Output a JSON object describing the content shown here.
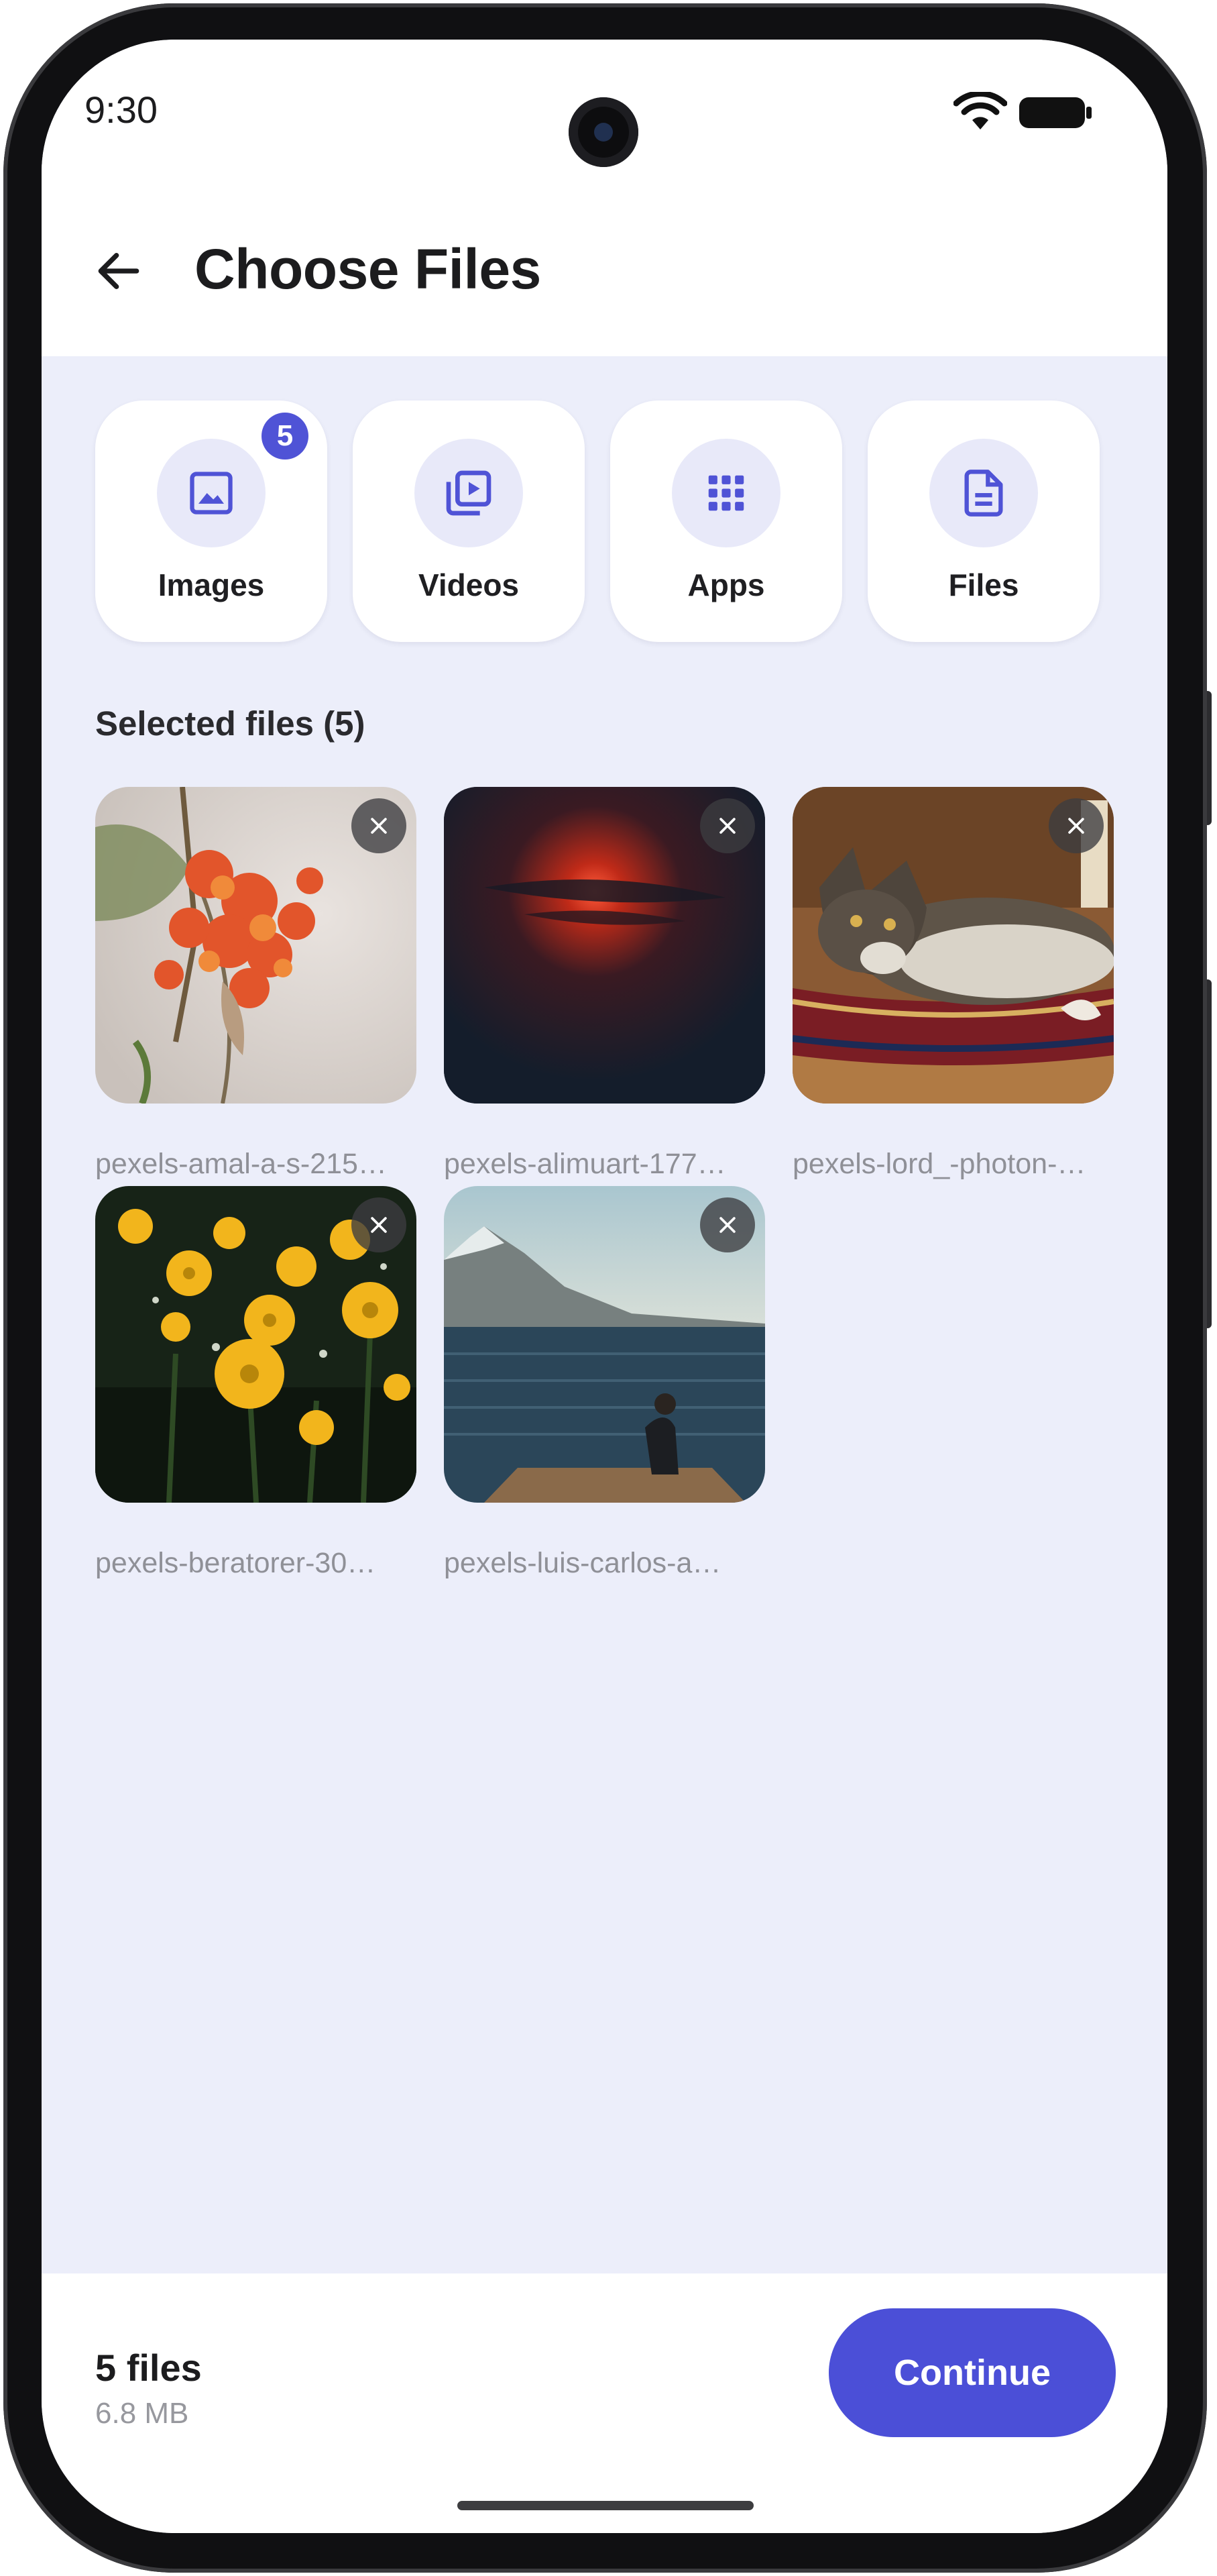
{
  "status_bar": {
    "time": "9:30",
    "wifi_icon": "wifi-icon",
    "battery_icon": "battery-icon"
  },
  "header": {
    "title": "Choose Files",
    "back_icon": "arrow-back-icon"
  },
  "categories": [
    {
      "label": "Images",
      "icon": "image-icon",
      "badge": "5"
    },
    {
      "label": "Videos",
      "icon": "video-library-icon"
    },
    {
      "label": "Apps",
      "icon": "apps-grid-icon"
    },
    {
      "label": "Files",
      "icon": "document-icon"
    }
  ],
  "selected": {
    "title": "Selected files (5)",
    "files": [
      {
        "name": "pexels-amal-a-s-215…"
      },
      {
        "name": "pexels-alimuart-177…"
      },
      {
        "name": "pexels-lord_-photon-…"
      },
      {
        "name": "pexels-beratorer-30…"
      },
      {
        "name": "pexels-luis-carlos-a…"
      }
    ]
  },
  "footer": {
    "count": "5 files",
    "size": "6.8 MB",
    "continue_label": "Continue"
  },
  "colors": {
    "accent": "#4b4fd7",
    "background": "#eceefa",
    "card": "#ffffff"
  }
}
